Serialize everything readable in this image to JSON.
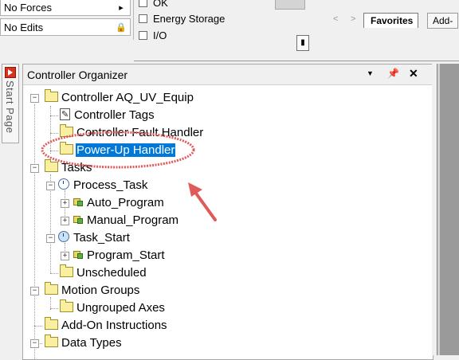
{
  "status": {
    "forces": "No Forces",
    "edits": "No Edits"
  },
  "checks": {
    "ok": "OK",
    "energy": "Energy Storage",
    "io": "I/O"
  },
  "tabs": {
    "favorites": "Favorites",
    "addon": "Add-"
  },
  "start_page": "Start Page",
  "organizer": {
    "title": "Controller Organizer",
    "tree": {
      "controller": "Controller AQ_UV_Equip",
      "controller_tags": "Controller Tags",
      "fault_handler": "Controller Fault Handler",
      "powerup_handler": "Power-Up Handler",
      "tasks": "Tasks",
      "process_task": "Process_Task",
      "auto_program": "Auto_Program",
      "manual_program": "Manual_Program",
      "task_start": "Task_Start",
      "program_start": "Program_Start",
      "unscheduled": "Unscheduled",
      "motion_groups": "Motion Groups",
      "ungrouped_axes": "Ungrouped Axes",
      "addon_instructions": "Add-On Instructions",
      "data_types": "Data Types"
    }
  },
  "colors": {
    "selection": "#0078d7",
    "annotation": "#e05a5a"
  }
}
